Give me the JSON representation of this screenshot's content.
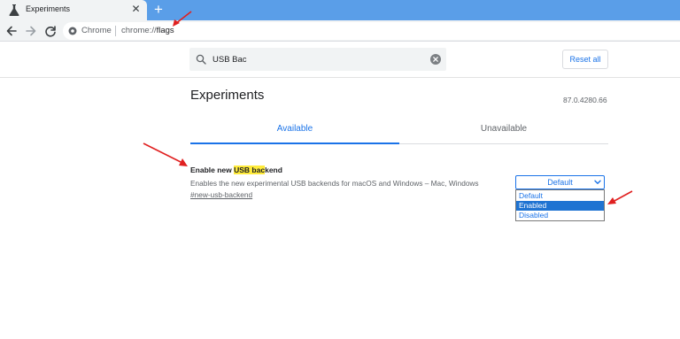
{
  "browser": {
    "tab_title": "Experiments",
    "omnibox": {
      "site_chip": "Chrome",
      "url_prefix": "chrome://",
      "url_path": "flags"
    }
  },
  "search": {
    "value": "USB Bac",
    "reset_label": "Reset all"
  },
  "page": {
    "title": "Experiments",
    "version": "87.0.4280.66",
    "tabs": [
      {
        "label": "Available",
        "active": true
      },
      {
        "label": "Unavailable",
        "active": false
      }
    ]
  },
  "flag": {
    "title_prefix": "Enable new ",
    "title_highlight": "USB bac",
    "title_suffix": "kend",
    "description": "Enables the new experimental USB backends for macOS and Windows – Mac, Windows",
    "link": "#new-usb-backend",
    "select_value": "Default",
    "options": [
      {
        "label": "Default",
        "selected": false
      },
      {
        "label": "Enabled",
        "selected": true
      },
      {
        "label": "Disabled",
        "selected": false
      }
    ]
  },
  "colors": {
    "accent": "#1a73e8",
    "highlight": "#ffeb3b",
    "annotation_arrow": "#e02020",
    "tabstrip": "#5a9ee8"
  },
  "icons": [
    "flask-icon",
    "close-icon",
    "plus-icon",
    "back-arrow-icon",
    "forward-arrow-icon",
    "refresh-icon",
    "chrome-site-icon",
    "search-icon",
    "clear-icon",
    "chevron-down-icon"
  ]
}
